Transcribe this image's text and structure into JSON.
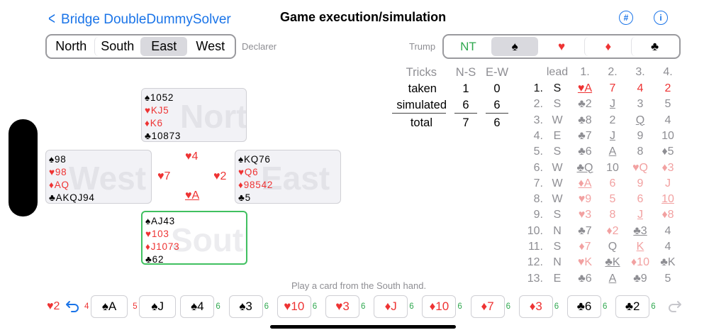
{
  "header": {
    "back_label": "Bridge DoubleDummySolver",
    "title": "Game execution/simulation",
    "hash_icon_label": "#",
    "info_icon_label": "i"
  },
  "declarer": {
    "options": [
      "North",
      "South",
      "East",
      "West"
    ],
    "selected": "East",
    "label": "Declarer"
  },
  "trump": {
    "label": "Trump",
    "options": [
      "NT",
      "♠",
      "♥",
      "♦",
      "♣"
    ],
    "selected": "♠"
  },
  "hands": {
    "north": {
      "name": "North",
      "spades": "♠1052",
      "hearts": "♥KJ5",
      "diamonds": "♦K6",
      "clubs": "♣10873"
    },
    "west": {
      "name": "West",
      "spades": "♠98",
      "hearts": "♥98",
      "diamonds": "♦AQ",
      "clubs": "♣AKQJ94"
    },
    "east": {
      "name": "East",
      "spades": "♠KQ76",
      "hearts": "♥Q6",
      "diamonds": "♦98542",
      "clubs": "♣5"
    },
    "south": {
      "name": "South",
      "spades": "♠AJ43",
      "hearts": "♥103",
      "diamonds": "♦J1073",
      "clubs": "♣62"
    }
  },
  "current_trick": {
    "north": "♥4",
    "west": "♥7",
    "east": "♥2",
    "south": "♥A"
  },
  "tricks_table": {
    "header": [
      "Tricks",
      "N-S",
      "E-W"
    ],
    "rows": [
      {
        "label": "taken",
        "ns": "1",
        "ew": "0"
      },
      {
        "label": "simulated",
        "ns": "6",
        "ew": "6"
      },
      {
        "label": "total",
        "ns": "7",
        "ew": "6"
      }
    ]
  },
  "play_history": {
    "header": [
      "lead",
      "1.",
      "2.",
      "3.",
      "4."
    ],
    "rows": [
      {
        "n": "1.",
        "lead": "S",
        "c": [
          "♥A",
          "7",
          "4",
          "2"
        ]
      },
      {
        "n": "2.",
        "lead": "S",
        "c": [
          "♣2",
          "J",
          "3",
          "5"
        ]
      },
      {
        "n": "3.",
        "lead": "W",
        "c": [
          "♣8",
          "2",
          "Q",
          "4"
        ]
      },
      {
        "n": "4.",
        "lead": "E",
        "c": [
          "♣7",
          "J",
          "9",
          "10"
        ]
      },
      {
        "n": "5.",
        "lead": "S",
        "c": [
          "♣6",
          "A",
          "8",
          "♦5"
        ]
      },
      {
        "n": "6.",
        "lead": "W",
        "c": [
          "♣Q",
          "10",
          "♥Q",
          "♦3"
        ]
      },
      {
        "n": "7.",
        "lead": "W",
        "c": [
          "♦A",
          "6",
          "9",
          "J"
        ]
      },
      {
        "n": "8.",
        "lead": "W",
        "c": [
          "♥9",
          "5",
          "6",
          "10"
        ]
      },
      {
        "n": "9.",
        "lead": "S",
        "c": [
          "♥3",
          "8",
          "J",
          "♦8"
        ]
      },
      {
        "n": "10.",
        "lead": "N",
        "c": [
          "♣7",
          "♦2",
          "♣3",
          "4"
        ]
      },
      {
        "n": "11.",
        "lead": "S",
        "c": [
          "♦7",
          "Q",
          "K",
          "4"
        ]
      },
      {
        "n": "12.",
        "lead": "N",
        "c": [
          "♥K",
          "♣K",
          "♦10",
          "♣K"
        ]
      },
      {
        "n": "13.",
        "lead": "E",
        "c": [
          "♣6",
          "A",
          "♣9",
          "5"
        ]
      }
    ]
  },
  "hint": "Play a card from the South hand.",
  "card_bar": {
    "last_card": "♥2",
    "undo_icon": "undo-arrow-icon",
    "redo_icon": "redo-arrow-icon",
    "cards": [
      {
        "pre": "4",
        "label": "♠A",
        "post": ""
      },
      {
        "pre": "5",
        "label": "♠J",
        "post": ""
      },
      {
        "pre": "",
        "label": "♠4",
        "post": "6"
      },
      {
        "pre": "",
        "label": "♠3",
        "post": "6"
      },
      {
        "pre": "",
        "label": "♥10",
        "post": "6"
      },
      {
        "pre": "",
        "label": "♥3",
        "post": "6"
      },
      {
        "pre": "",
        "label": "♦J",
        "post": "6"
      },
      {
        "pre": "",
        "label": "♦10",
        "post": "6"
      },
      {
        "pre": "",
        "label": "♦7",
        "post": "6"
      },
      {
        "pre": "",
        "label": "♦3",
        "post": "6"
      },
      {
        "pre": "",
        "label": "♣6",
        "post": "6"
      },
      {
        "pre": "",
        "label": "♣2",
        "post": "6"
      }
    ]
  },
  "colors": {
    "accent": "#1a74e8",
    "red_suit": "#ee3333",
    "green": "#2fa84f",
    "selected_bg": "#d9d9de"
  }
}
